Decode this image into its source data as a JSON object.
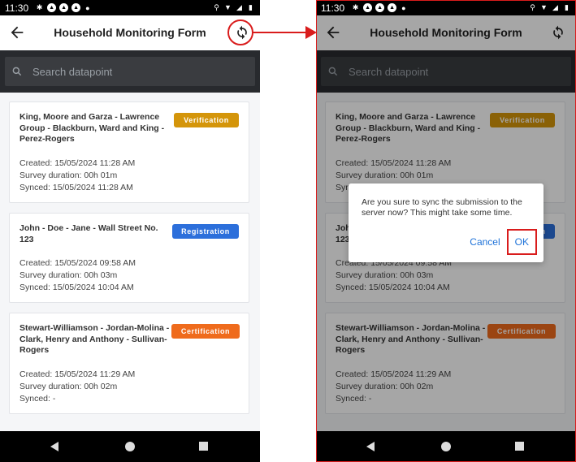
{
  "status_bar": {
    "time": "11:30"
  },
  "app_bar": {
    "title": "Household Monitoring Form"
  },
  "search": {
    "placeholder": "Search datapoint"
  },
  "cards": [
    {
      "name": "King, Moore and Garza - Lawrence Group - Blackburn, Ward and King - Perez-Rogers",
      "badge": "Verification",
      "badge_color": "#d4950a",
      "created": "Created: 15/05/2024 11:28 AM",
      "duration": "Survey duration: 00h 01m",
      "synced": "Synced: 15/05/2024 11:28 AM"
    },
    {
      "name": "John - Doe - Jane - Wall Street No. 123",
      "badge": "Registration",
      "badge_color": "#2c6fdb",
      "created": "Created: 15/05/2024 09:58 AM",
      "duration": "Survey duration: 00h 03m",
      "synced": "Synced: 15/05/2024 10:04 AM"
    },
    {
      "name": "Stewart-Williamson - Jordan-Molina - Clark, Henry and Anthony - Sullivan-Rogers",
      "badge": "Certification",
      "badge_color": "#ef6b1c",
      "created": "Created: 15/05/2024 11:29 AM",
      "duration": "Survey duration: 00h 02m",
      "synced": "Synced: -"
    }
  ],
  "dialog": {
    "message": "Are you sure to sync the submission to the server now? This might take some time.",
    "cancel_label": "Cancel",
    "ok_label": "OK"
  },
  "colors": {
    "annotation": "#d91c1c",
    "accent": "#1f73d9"
  }
}
